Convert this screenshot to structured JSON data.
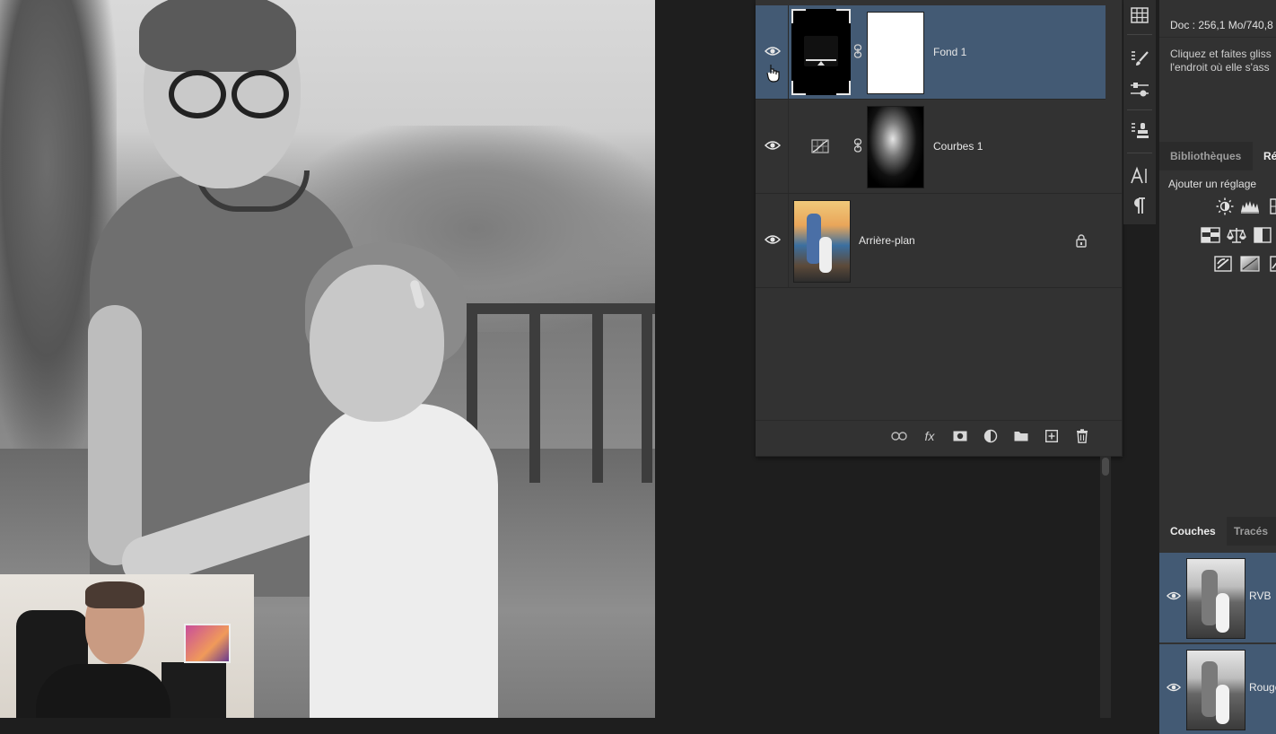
{
  "layers_panel": {
    "layers": [
      {
        "name": "Fond 1",
        "selected": true,
        "kind": "solid-color-fill",
        "mask": "white"
      },
      {
        "name": "Courbes 1",
        "selected": false,
        "kind": "curves-adjustment",
        "mask": "silhouette"
      },
      {
        "name": "Arrière-plan",
        "selected": false,
        "kind": "background-photo",
        "locked": true
      }
    ],
    "footer_icons": [
      "link-icon",
      "fx-icon",
      "mask-icon",
      "adjustment-icon",
      "folder-icon",
      "new-layer-icon",
      "trash-icon"
    ],
    "fx_label": "fx"
  },
  "tool_strip": {
    "icons": [
      "table-icon",
      "brush-preset-icon",
      "adjust-sliders-icon",
      "clone-source-icon",
      "character-icon",
      "paragraph-icon"
    ]
  },
  "info_panel": {
    "doc": "Doc : 256,1 Mo/740,8",
    "hint": "Cliquez et faites gliss\nl'endroit où elle s'ass"
  },
  "libraries_tabs": {
    "tabs": [
      "Bibliothèques",
      "Ré"
    ],
    "active_index": 1
  },
  "adjustments": {
    "title": "Ajouter un réglage",
    "icons": [
      "brightness-icon",
      "levels-icon",
      "curves-icon",
      "exposure-icon",
      "color-balance-icon",
      "bw-icon",
      "invert-icon",
      "gradient-map-icon",
      "selective-color-icon"
    ]
  },
  "channels_tabs": {
    "tabs": [
      "Couches",
      "Tracés"
    ],
    "active_index": 0
  },
  "channels": [
    {
      "name": "RVB"
    },
    {
      "name": "Rouge"
    }
  ],
  "colors": {
    "selection": "#435a74",
    "panel": "#323232",
    "background": "#1e1e1e"
  }
}
